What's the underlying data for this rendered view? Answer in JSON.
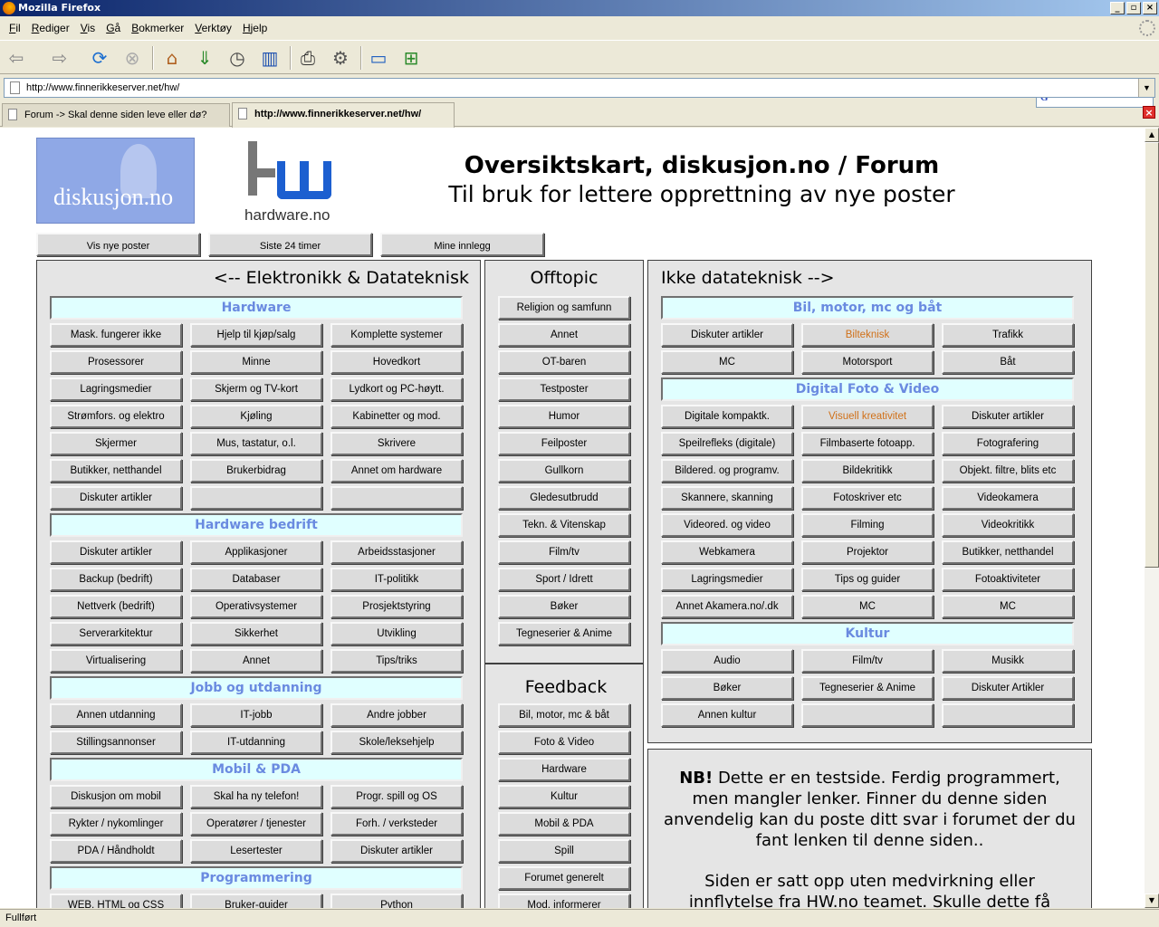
{
  "window": {
    "title": "Mozilla Firefox"
  },
  "menu": [
    {
      "key": "F",
      "rest": "il"
    },
    {
      "key": "R",
      "rest": "ediger"
    },
    {
      "key": "V",
      "rest": "is"
    },
    {
      "key": "G",
      "rest": "å"
    },
    {
      "key": "B",
      "rest": "okmerker"
    },
    {
      "key": "V",
      "rest": "erktøy"
    },
    {
      "key": "H",
      "rest": "jelp"
    }
  ],
  "urlbar": {
    "value": "http://www.finnerikkeserver.net/hw/"
  },
  "search": {
    "value": "G"
  },
  "tabs": [
    {
      "label": "Forum -> Skal denne siden leve eller dø?"
    },
    {
      "label": "http://www.finnerikkeserver.net/hw/"
    }
  ],
  "status": {
    "text": "Fullført"
  },
  "page": {
    "logo_disk": "diskusjon.no",
    "logo_hw": "hardware.no",
    "title": "Oversiktskart, diskusjon.no / Forum",
    "subtitle": "Til bruk for lettere opprettning av nye poster",
    "top_buttons": [
      "Vis nye poster",
      "Siste 24 timer",
      "Mine innlegg"
    ],
    "left": {
      "title": "<-- Elektronikk & Datateknisk",
      "sections": [
        {
          "name": "Hardware",
          "items": [
            "Mask. fungerer ikke",
            "Hjelp til kjøp/salg",
            "Komplette systemer",
            "Prosessorer",
            "Minne",
            "Hovedkort",
            "Lagringsmedier",
            "Skjerm og TV-kort",
            "Lydkort og PC-høytt.",
            "Strømfors. og elektro",
            "Kjøling",
            "Kabinetter og mod.",
            "Skjermer",
            "Mus, tastatur, o.l.",
            "Skrivere",
            "Butikker, netthandel",
            "Brukerbidrag",
            "Annet om hardware",
            "Diskuter artikler",
            "",
            ""
          ]
        },
        {
          "name": "Hardware bedrift",
          "items": [
            "Diskuter artikler",
            "Applikasjoner",
            "Arbeidsstasjoner",
            "Backup (bedrift)",
            "Databaser",
            "IT-politikk",
            "Nettverk (bedrift)",
            "Operativsystemer",
            "Prosjektstyring",
            "Serverarkitektur",
            "Sikkerhet",
            "Utvikling",
            "Virtualisering",
            "Annet",
            "Tips/triks"
          ]
        },
        {
          "name": "Jobb og utdanning",
          "items": [
            "Annen utdanning",
            "IT-jobb",
            "Andre jobber",
            "Stillingsannonser",
            "IT-utdanning",
            "Skole/leksehjelp"
          ]
        },
        {
          "name": "Mobil & PDA",
          "items": [
            "Diskusjon om mobil",
            "Skal ha ny telefon!",
            "Progr. spill og OS",
            "Rykter / nykomlinger",
            "Operatører / tjenester",
            "Forh. / verksteder",
            "PDA / Håndholdt",
            "Lesertester",
            "Diskuter artikler"
          ]
        },
        {
          "name": "Programmering",
          "items": [
            "WEB, HTML og CSS",
            "Bruker-guider",
            "Python"
          ]
        }
      ]
    },
    "middle": {
      "title": "Offtopic",
      "items": [
        "Religion og samfunn",
        "Annet",
        "OT-baren",
        "Testposter",
        "Humor",
        "Feilposter",
        "Gullkorn",
        "Gledesutbrudd",
        "Tekn. & Vitenskap",
        "Film/tv",
        "Sport / Idrett",
        "Bøker",
        "Tegneserier & Anime"
      ],
      "feedback_title": "Feedback",
      "feedback_items": [
        "Bil, motor, mc & båt",
        "Foto & Video",
        "Hardware",
        "Kultur",
        "Mobil & PDA",
        "Spill",
        "Forumet generelt",
        "Mod. informerer"
      ]
    },
    "right": {
      "title": "Ikke datateknisk -->",
      "sections": [
        {
          "name": "Bil, motor, mc og båt",
          "items": [
            "Diskuter artikler",
            "Bilteknisk",
            "Trafikk",
            "MC",
            "Motorsport",
            "Båt"
          ]
        },
        {
          "name": "Digital Foto & Video",
          "items": [
            "Digitale kompaktk.",
            "Visuell kreativitet",
            "Diskuter artikler",
            "Speilrefleks (digitale)",
            "Filmbaserte fotoapp.",
            "Fotografering",
            "Bildered. og programv.",
            "Bildekritikk",
            "Objekt. filtre, blits etc",
            "Skannere, skanning",
            "Fotoskriver etc",
            "Videokamera",
            "Videored. og video",
            "Filming",
            "Videokritikk",
            "Webkamera",
            "Projektor",
            "Butikker, netthandel",
            "Lagringsmedier",
            "Tips og guider",
            "Fotoaktiviteter",
            "Annet Akamera.no/.dk",
            "MC",
            "MC"
          ]
        },
        {
          "name": "Kultur",
          "items": [
            "Audio",
            "Film/tv",
            "Musikk",
            "Bøker",
            "Tegneserier & Anime",
            "Diskuter Artikler",
            "Annen kultur",
            "",
            ""
          ]
        }
      ],
      "orange_items": [
        "Bilteknisk",
        "Visuell kreativitet"
      ]
    },
    "note": {
      "bold": "NB!",
      "text": "Dette er en testside. Ferdig programmert, men mangler lenker. Finner du denne siden anvendelig kan du poste ditt svar i forumet der du fant lenken til denne siden..",
      "text2": "Siden er satt opp uten medvirkning eller innflytelse fra HW.no teamet. Skulle dette få"
    }
  },
  "colors": {
    "category_bg": "#e0ffff",
    "category_text": "#6a8ae0",
    "orange_link": "#d07018",
    "panel_bg": "#e5e5e5"
  }
}
